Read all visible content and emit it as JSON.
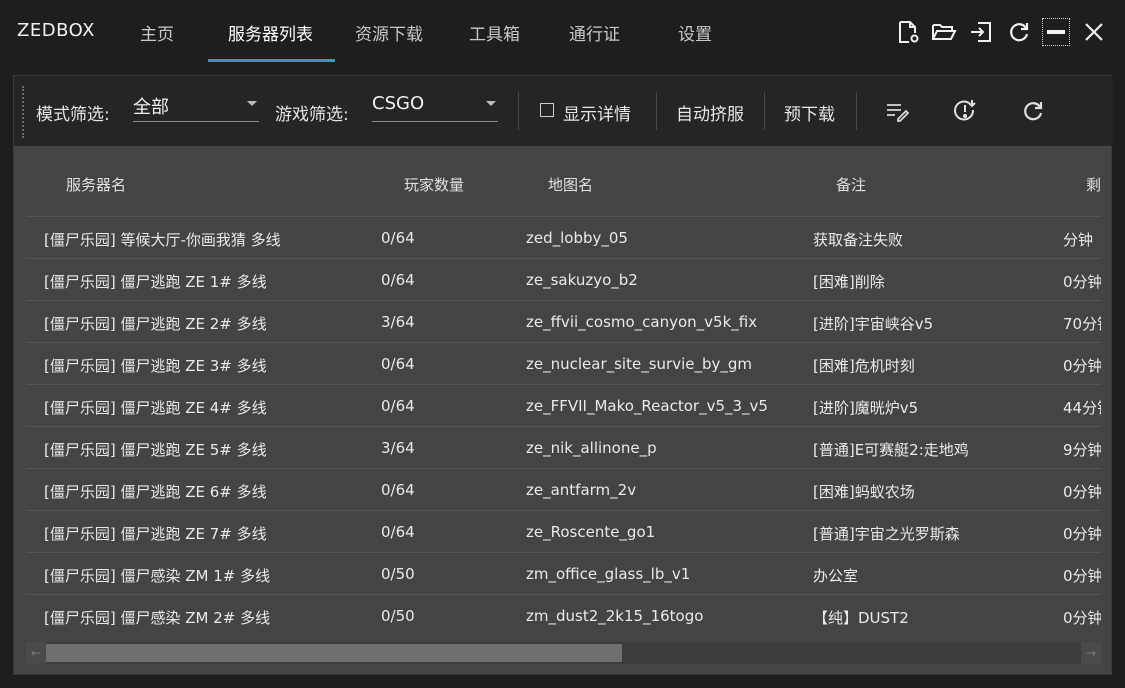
{
  "app": {
    "brand": "ZEDBOX"
  },
  "nav": {
    "tabs": [
      {
        "label": "主页"
      },
      {
        "label": "服务器列表"
      },
      {
        "label": "资源下载"
      },
      {
        "label": "工具箱"
      },
      {
        "label": "通行证"
      },
      {
        "label": "设置"
      }
    ],
    "active": "服务器列表"
  },
  "window_controls": [
    "file-settings-icon",
    "folder-open-icon",
    "exit-icon",
    "refresh-icon",
    "minimize-icon",
    "close-icon"
  ],
  "toolbar": {
    "mode_filter_label": "模式筛选:",
    "mode_filter_value": "全部",
    "game_filter_label": "游戏筛选:",
    "game_filter_value": "CSGO",
    "show_details_label": "显示详情",
    "show_details_checked": false,
    "auto_join_label": "自动挤服",
    "predownload_label": "预下载",
    "icons": [
      "edit-list-icon",
      "alert-download-icon",
      "refresh-icon"
    ]
  },
  "table": {
    "columns": [
      "服务器名",
      "玩家数量",
      "地图名",
      "备注",
      "剩"
    ],
    "rows": [
      [
        "[僵尸乐园] 等候大厅-你画我猜 多线",
        "0/64",
        "zed_lobby_05",
        "获取备注失败",
        "分钟"
      ],
      [
        "[僵尸乐园] 僵尸逃跑 ZE 1# 多线",
        "0/64",
        "ze_sakuzyo_b2",
        "[困难]削除",
        "0分钟"
      ],
      [
        "[僵尸乐园] 僵尸逃跑 ZE 2# 多线",
        "3/64",
        "ze_ffvii_cosmo_canyon_v5k_fix",
        "[进阶]宇宙峡谷v5",
        "70分钟"
      ],
      [
        "[僵尸乐园] 僵尸逃跑 ZE 3# 多线",
        "0/64",
        "ze_nuclear_site_survie_by_gm",
        "[困难]危机时刻",
        "0分钟"
      ],
      [
        "[僵尸乐园] 僵尸逃跑 ZE 4# 多线",
        "0/64",
        "ze_FFVII_Mako_Reactor_v5_3_v5",
        "[进阶]魔晄炉v5",
        "44分钟"
      ],
      [
        "[僵尸乐园] 僵尸逃跑 ZE 5# 多线",
        "3/64",
        "ze_nik_allinone_p",
        "[普通]E可赛艇2:走地鸡",
        "9分钟"
      ],
      [
        "[僵尸乐园] 僵尸逃跑 ZE 6# 多线",
        "0/64",
        "ze_antfarm_2v",
        "[困难]蚂蚁农场",
        "0分钟"
      ],
      [
        "[僵尸乐园] 僵尸逃跑 ZE 7# 多线",
        "0/64",
        "ze_Roscente_go1",
        "[普通]宇宙之光罗斯森",
        "0分钟"
      ],
      [
        "[僵尸乐园] 僵尸感染 ZM 1# 多线",
        "0/50",
        "zm_office_glass_lb_v1",
        "办公室",
        "0分钟"
      ],
      [
        "[僵尸乐园] 僵尸感染 ZM 2# 多线",
        "0/50",
        "zm_dust2_2k15_16togo",
        "【纯】DUST2",
        "0分钟"
      ]
    ]
  },
  "colors": {
    "accent": "#3d8ddb",
    "background": "#1e1e1e",
    "panel": "#444444",
    "toolbar": "#252525"
  }
}
